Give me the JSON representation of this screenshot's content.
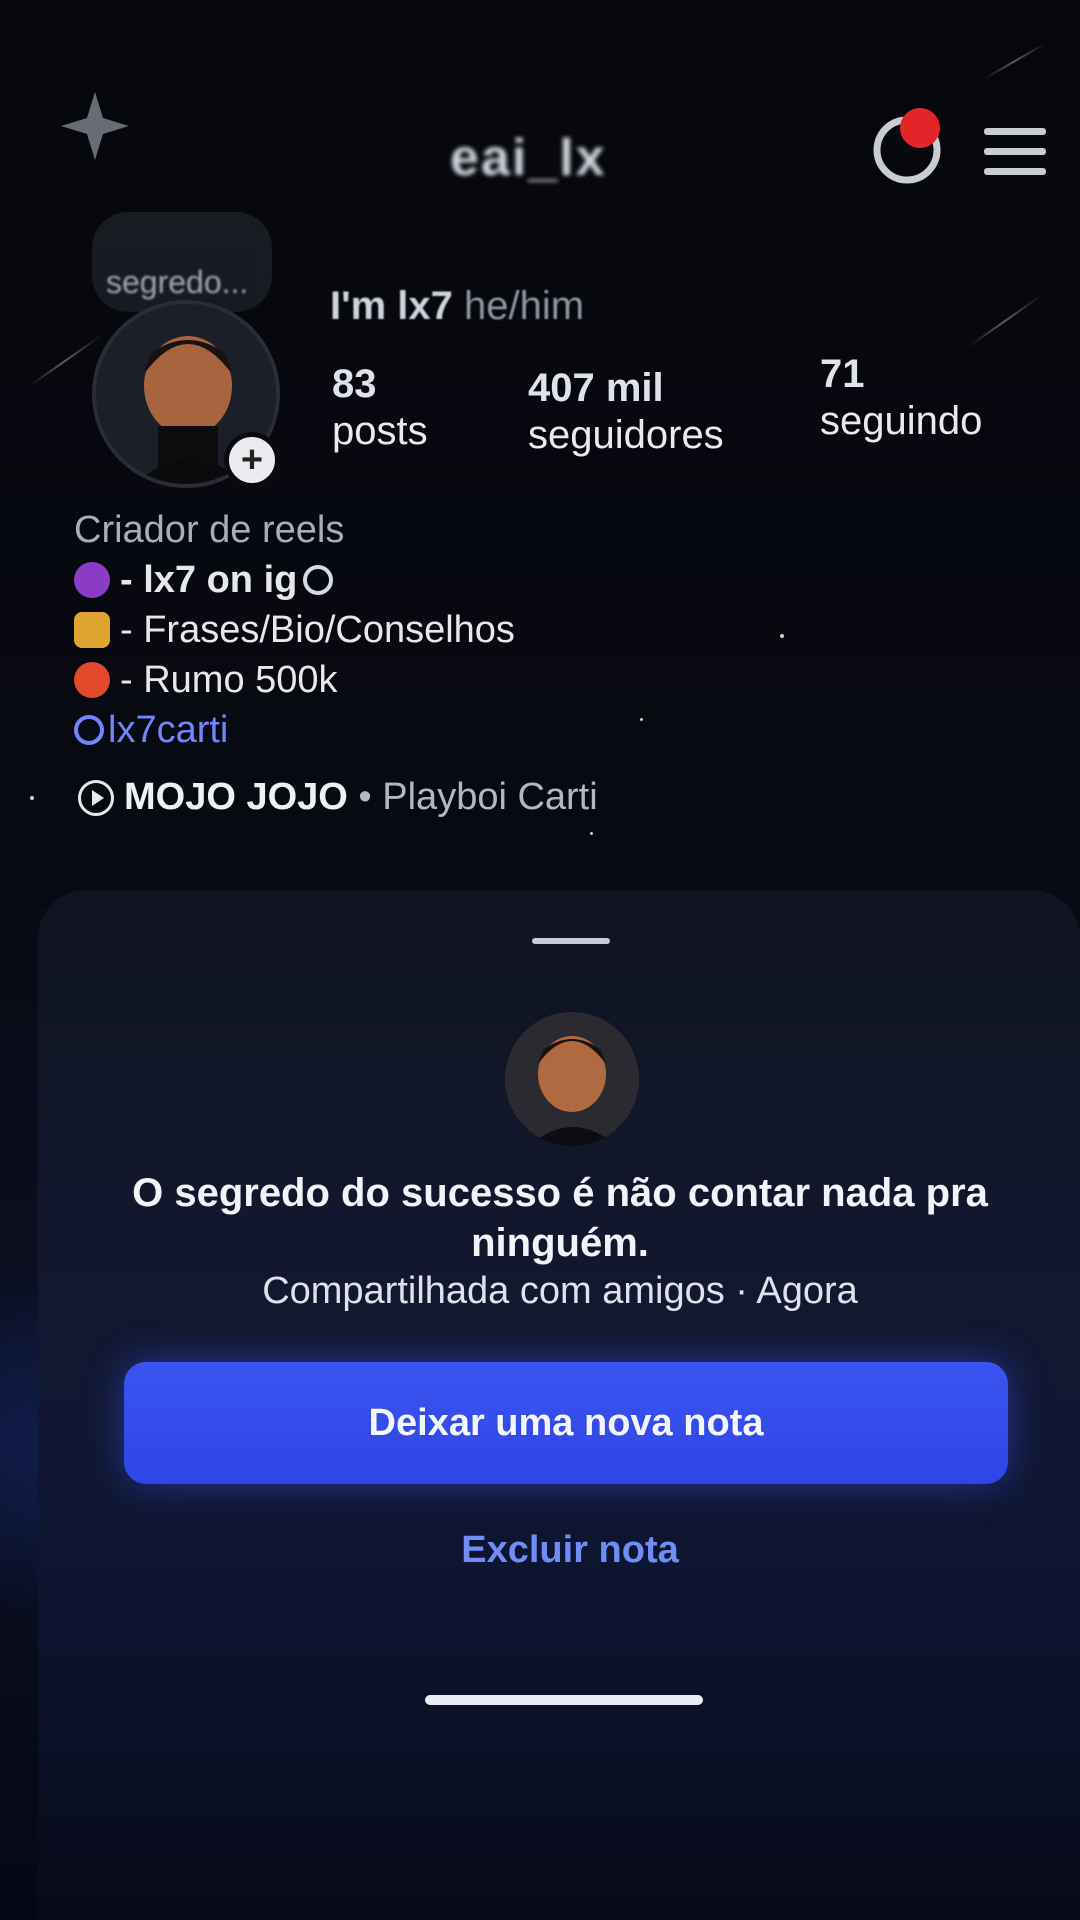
{
  "header": {
    "username": "eai_lx",
    "icons": [
      "sparkle-icon",
      "threads-icon",
      "menu-icon"
    ]
  },
  "profile": {
    "note_bubble": "segredo...",
    "pronoun_name": "I'm lx7",
    "pronoun_sub": "he/him",
    "stats": [
      {
        "num": "83",
        "label": "posts"
      },
      {
        "num": "407 mil",
        "label": "seguidores"
      },
      {
        "num": "71",
        "label": "seguindo"
      }
    ],
    "bio": {
      "category": "Criador de reels",
      "lines": [
        {
          "text": "- lx7 on ig",
          "emoji": "devil-emoji"
        },
        {
          "text": "- Frases/Bio/Conselhos",
          "emoji": "pencil-emoji"
        },
        {
          "text": "- Rumo 500k",
          "emoji": "heart-fire-emoji"
        }
      ],
      "link": "lx7carti"
    },
    "music": {
      "song": "MOJO JOJO",
      "separator": " • ",
      "artist": "Playboi Carti"
    }
  },
  "sheet": {
    "note_text": "O segredo do sucesso é não contar nada pra ninguém.",
    "meta": "Compartilhada com amigos · Agora",
    "primary_button": "Deixar uma nova nota",
    "secondary_button": "Excluir nota"
  },
  "colors": {
    "accent": "#3b54f0",
    "link": "#6f86ff",
    "background": "#05060b"
  }
}
